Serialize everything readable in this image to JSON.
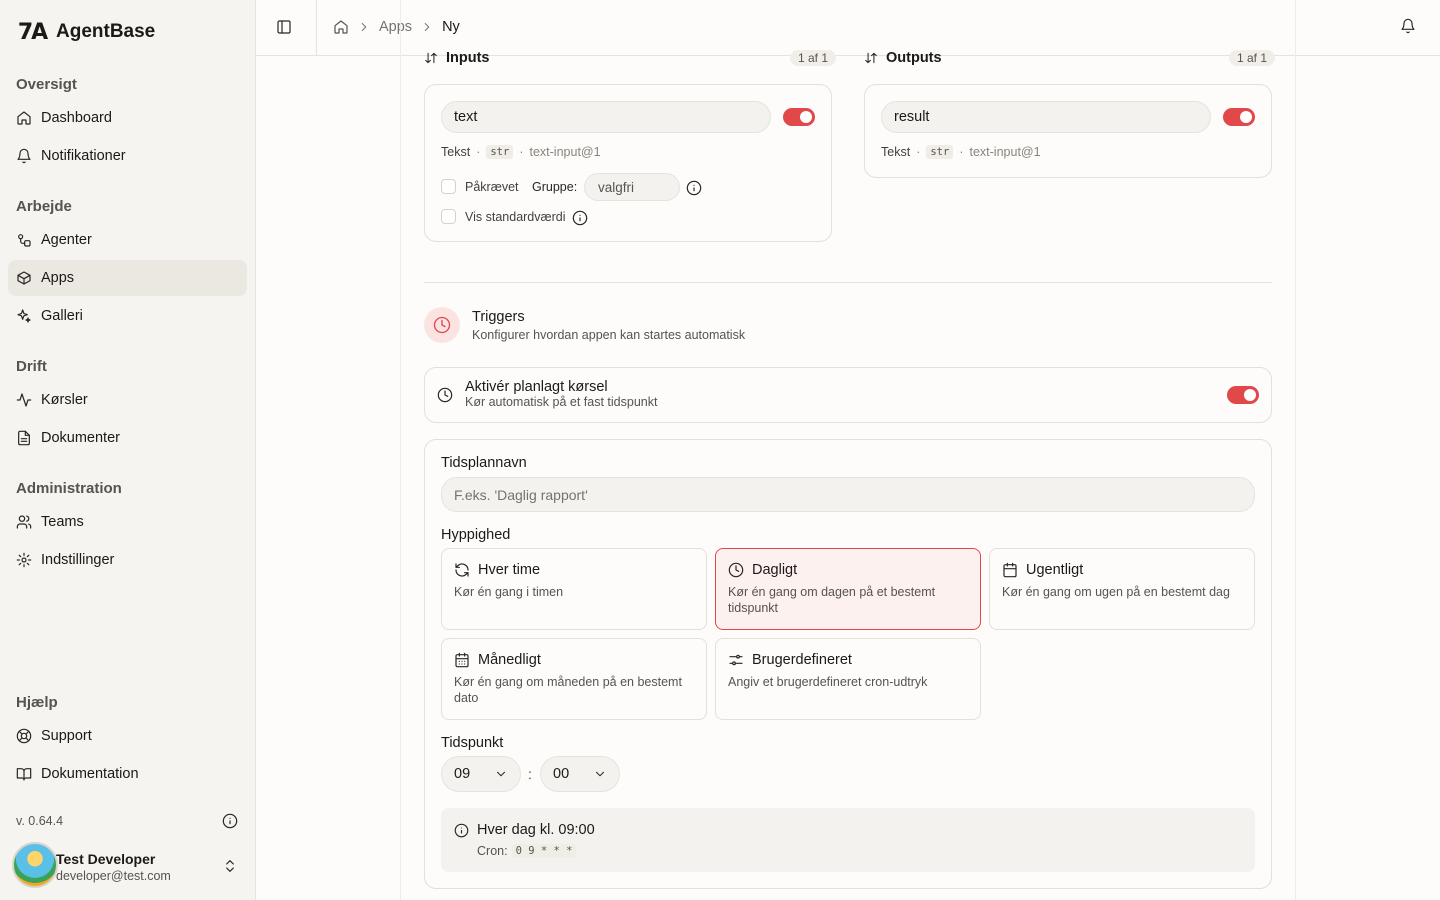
{
  "app": {
    "name": "AgentBase",
    "logo_text": "7A"
  },
  "sidebar": {
    "sections": [
      {
        "label": "Oversigt",
        "items": [
          {
            "label": "Dashboard",
            "icon": "home-icon"
          },
          {
            "label": "Notifikationer",
            "icon": "bell-icon"
          }
        ]
      },
      {
        "label": "Arbejde",
        "items": [
          {
            "label": "Agenter",
            "icon": "agent-icon"
          },
          {
            "label": "Apps",
            "icon": "box-icon",
            "active": true
          },
          {
            "label": "Galleri",
            "icon": "sparkles-icon"
          }
        ]
      },
      {
        "label": "Drift",
        "items": [
          {
            "label": "Kørsler",
            "icon": "activity-icon"
          },
          {
            "label": "Dokumenter",
            "icon": "document-icon"
          }
        ]
      },
      {
        "label": "Administration",
        "items": [
          {
            "label": "Teams",
            "icon": "users-icon"
          },
          {
            "label": "Indstillinger",
            "icon": "gear-icon"
          }
        ]
      },
      {
        "label": "Hjælp",
        "items": [
          {
            "label": "Support",
            "icon": "lifebuoy-icon"
          },
          {
            "label": "Dokumentation",
            "icon": "book-icon"
          }
        ]
      }
    ],
    "version": "v. 0.64.4",
    "user": {
      "name": "Test Developer",
      "email": "developer@test.com"
    }
  },
  "breadcrumb": {
    "parent": "Apps",
    "current": "Ny"
  },
  "inputs": {
    "title": "Inputs",
    "count": "1 af 1",
    "field": {
      "name": "text",
      "type_label": "Tekst",
      "type_tag": "str",
      "source": "text-input@1"
    },
    "required_label": "Påkrævet",
    "group_label": "Gruppe:",
    "group_placeholder": "valgfri",
    "show_default_label": "Vis standardværdi"
  },
  "outputs": {
    "title": "Outputs",
    "count": "1 af 1",
    "field": {
      "name": "result",
      "type_label": "Tekst",
      "type_tag": "str",
      "source": "text-input@1"
    }
  },
  "triggers": {
    "title": "Triggers",
    "subtitle": "Konfigurer hvordan appen kan startes automatisk",
    "schedule": {
      "title": "Aktivér planlagt kørsel",
      "subtitle": "Kør automatisk på et fast tidspunkt",
      "enabled": true
    },
    "name_label": "Tidsplannavn",
    "name_placeholder": "F.eks. 'Daglig rapport'",
    "frequency_label": "Hyppighed",
    "frequencies": [
      {
        "title": "Hver time",
        "desc": "Kør én gang i timen",
        "icon": "refresh-icon"
      },
      {
        "title": "Dagligt",
        "desc": "Kør én gang om dagen på et bestemt tidspunkt",
        "icon": "clock-icon",
        "selected": true
      },
      {
        "title": "Ugentligt",
        "desc": "Kør én gang om ugen på en bestemt dag",
        "icon": "calendar-icon"
      },
      {
        "title": "Månedligt",
        "desc": "Kør én gang om måneden på en bestemt dato",
        "icon": "calendar-grid-icon"
      },
      {
        "title": "Brugerdefineret",
        "desc": "Angiv et brugerdefineret cron-udtryk",
        "icon": "sliders-icon"
      }
    ],
    "time_label": "Tidspunkt",
    "hour": "09",
    "separator": ":",
    "minute": "00",
    "summary": {
      "title": "Hver dag kl. 09:00",
      "cron_label": "Cron:",
      "cron": "0 9 * * *"
    }
  },
  "colors": {
    "accent": "#e0484a",
    "accent_bg": "#fdf1ef",
    "sidebar_bg": "#f6f4f0"
  }
}
